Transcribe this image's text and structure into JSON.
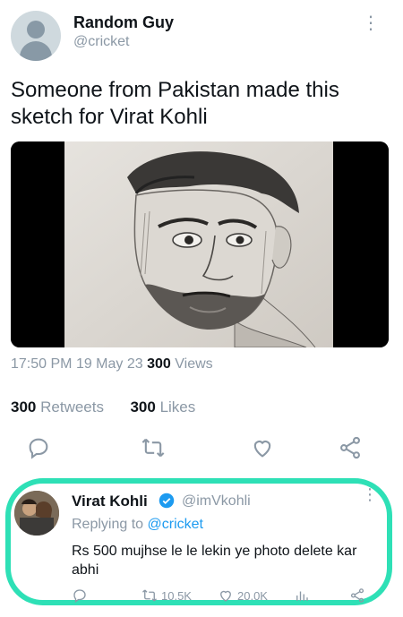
{
  "tweet": {
    "author_name": "Random Guy",
    "author_handle": "@cricket",
    "more_icon": "more-vertical-icon",
    "text": "Someone from Pakistan made this sketch for Virat Kohli",
    "time": "17:50 PM",
    "date": "19 May 23",
    "views_count": "300",
    "views_label": "Views",
    "retweets_count": "300",
    "retweets_label": "Retweets",
    "likes_count": "300",
    "likes_label": "Likes",
    "actions": [
      "reply-icon",
      "retweet-icon",
      "like-icon",
      "share-icon"
    ]
  },
  "reply": {
    "author_name": "Virat Kohli",
    "author_handle": "@imVkohli",
    "replying_prefix": "Replying to",
    "replying_to": "@cricket",
    "text": "Rs 500 mujhse le le lekin ye photo delete kar abhi",
    "retweets": "10.5K",
    "likes": "20.0K",
    "highlight_color": "#2ee0b6"
  },
  "colors": {
    "accent": "#1d9bf0",
    "secondary_text": "#8b98a5",
    "primary_text": "#0f1419"
  }
}
